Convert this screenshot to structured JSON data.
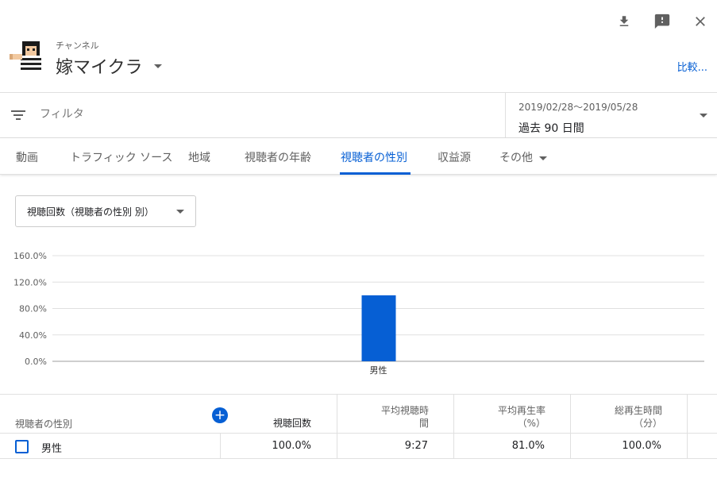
{
  "toolbar": {
    "icons": [
      "download-icon",
      "feedback-icon",
      "close-icon"
    ]
  },
  "channel": {
    "label": "チャンネル",
    "name": "嫁マイクラ",
    "compare": "比較..."
  },
  "filter": {
    "placeholder": "フィルタ",
    "date_range": "2019/02/28～2019/05/28",
    "date_label": "過去 90 日間"
  },
  "tabs": [
    {
      "label": "動画"
    },
    {
      "label": "トラフィック ソース"
    },
    {
      "label": "地域"
    },
    {
      "label": "視聴者の年齢"
    },
    {
      "label": "視聴者の性別"
    },
    {
      "label": "収益源"
    },
    {
      "label": "その他"
    }
  ],
  "active_tab": "視聴者の性別",
  "metric_select": {
    "value": "視聴回数（視聴者の性別 別）"
  },
  "colors": {
    "accent": "#065fd4",
    "bar": "#065fd4",
    "grid": "#e0e0e0",
    "text_secondary": "#606060"
  },
  "chart_data": {
    "type": "bar",
    "categories": [
      "男性"
    ],
    "values": [
      100.0
    ],
    "yticks": [
      "0.0%",
      "40.0%",
      "80.0%",
      "120.0%",
      "160.0%"
    ],
    "ylim": [
      0,
      160
    ],
    "grid": true
  },
  "table": {
    "dimension_header": "視聴者の性別",
    "columns": [
      {
        "label": "視聴回数"
      },
      {
        "label": "平均視聴時\n間"
      },
      {
        "label": "平均再生率\n（%）"
      },
      {
        "label": "総再生時間\n（分）"
      }
    ],
    "rows": [
      {
        "label": "男性",
        "values": [
          "100.0%",
          "9:27",
          "81.0%",
          "100.0%"
        ]
      }
    ]
  }
}
